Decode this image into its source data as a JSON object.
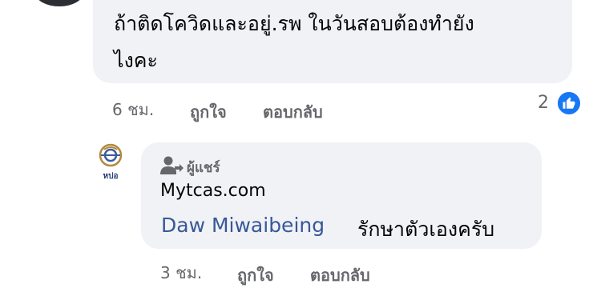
{
  "comment1": {
    "text_line1": "ถ้าติดโควิดและอยู่.รพ ในวันสอบต้องทำยัง",
    "text_line2": "ไงคะ",
    "time": "6 ชม.",
    "like_label": "ถูกใจ",
    "reply_label": "ตอบกลับ",
    "reaction_count": "2",
    "reaction_icon": "thumbs-up-icon",
    "reaction_color": "#1877f2"
  },
  "comment2": {
    "avatar_caption": "หปอ",
    "sharer_label": "ผู้แชร์",
    "site_name": "Mytcas.com",
    "mention": "Daw Miwaibeing",
    "text": "รักษาตัวเองครับ",
    "time": "3 ชม.",
    "like_label": "ถูกใจ",
    "reply_label": "ตอบกลับ",
    "mention_color": "#385898"
  },
  "colors": {
    "bubble": "#f0f2f5",
    "meta_text": "#65676b",
    "body_text": "#050505"
  }
}
